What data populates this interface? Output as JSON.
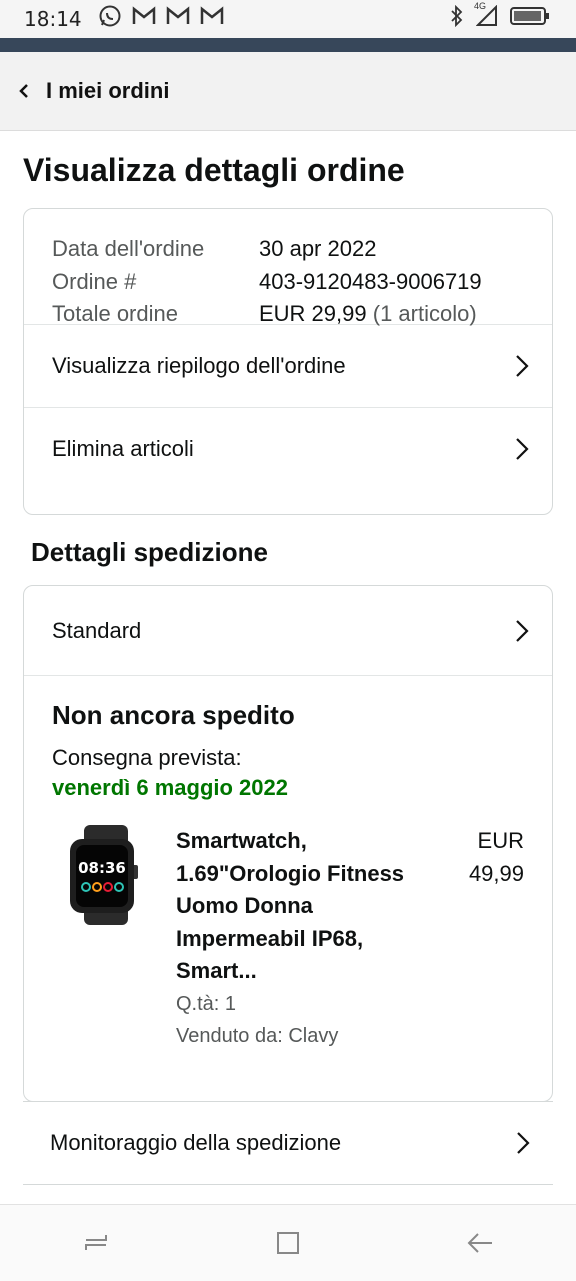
{
  "status_bar": {
    "time": "18:14",
    "network": "4G",
    "icons": [
      "whatsapp-icon",
      "gmail-icon",
      "gmail-icon",
      "gmail-icon",
      "bluetooth-icon",
      "signal-icon",
      "battery-icon"
    ]
  },
  "nav": {
    "back_label": "I miei ordini"
  },
  "page": {
    "title": "Visualizza dettagli ordine"
  },
  "order": {
    "date_label": "Data dell'ordine",
    "date_value": "30 apr 2022",
    "number_label": "Ordine #",
    "number_value": "403-9120483-9006719",
    "total_label": "Totale ordine",
    "total_value": "EUR 29,99",
    "total_count": "(1 articolo)",
    "summary_link": "Visualizza riepilogo dell'ordine",
    "remove_link": "Elimina articoli"
  },
  "shipping": {
    "section_title": "Dettagli spedizione",
    "method": "Standard",
    "status": "Non ancora spedito",
    "eta_label": "Consegna prevista:",
    "eta_date": "venerdì 6 maggio 2022",
    "item": {
      "title": "Smartwatch, 1.69\"Orologio Fitness Uomo Donna Impermeabil IP68, Smart...",
      "qty": "Q.tà: 1",
      "seller": "Venduto da: Clavy",
      "price_currency": "EUR",
      "price_amount": "49,99",
      "watch_time": "08:36"
    },
    "tracking_link": "Monitoraggio della spedizione"
  },
  "colors": {
    "accent_green": "#007600",
    "header_strip": "#37475a",
    "border": "#d5d9d9"
  }
}
